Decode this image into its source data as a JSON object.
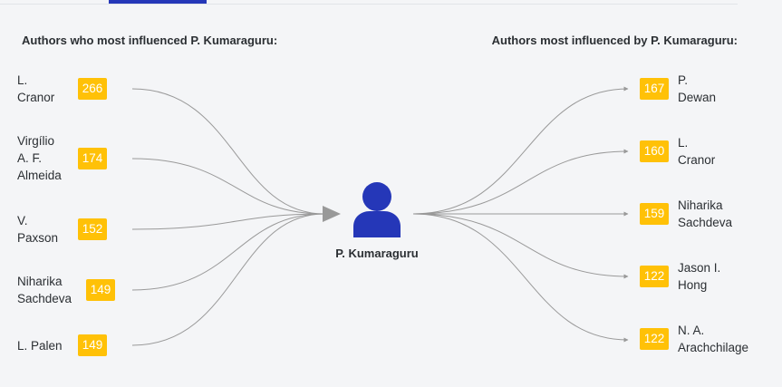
{
  "headings": {
    "left": "Authors who most influenced P. Kumaraguru:",
    "right": "Authors most influenced by P. Kumaraguru:"
  },
  "center": {
    "name": "P. Kumaraguru",
    "icon": "person-icon",
    "color": "#2537b8"
  },
  "influencers": [
    {
      "name": "L.\nCranor",
      "count": "266"
    },
    {
      "name": "Virgílio\nA. F.\nAlmeida",
      "count": "174"
    },
    {
      "name": "V.\nPaxson",
      "count": "152"
    },
    {
      "name": "Niharika\nSachdeva",
      "count": "149"
    },
    {
      "name": "L. Palen",
      "count": "149"
    }
  ],
  "influenced": [
    {
      "name": "P.\nDewan",
      "count": "167"
    },
    {
      "name": "L.\nCranor",
      "count": "160"
    },
    {
      "name": "Niharika\nSachdeva",
      "count": "159"
    },
    {
      "name": "Jason I.\nHong",
      "count": "122"
    },
    {
      "name": "N. A.\nArachchilage",
      "count": "122"
    }
  ],
  "colors": {
    "badge": "#ffc107",
    "edge": "#999999",
    "accent": "#2537b8"
  }
}
